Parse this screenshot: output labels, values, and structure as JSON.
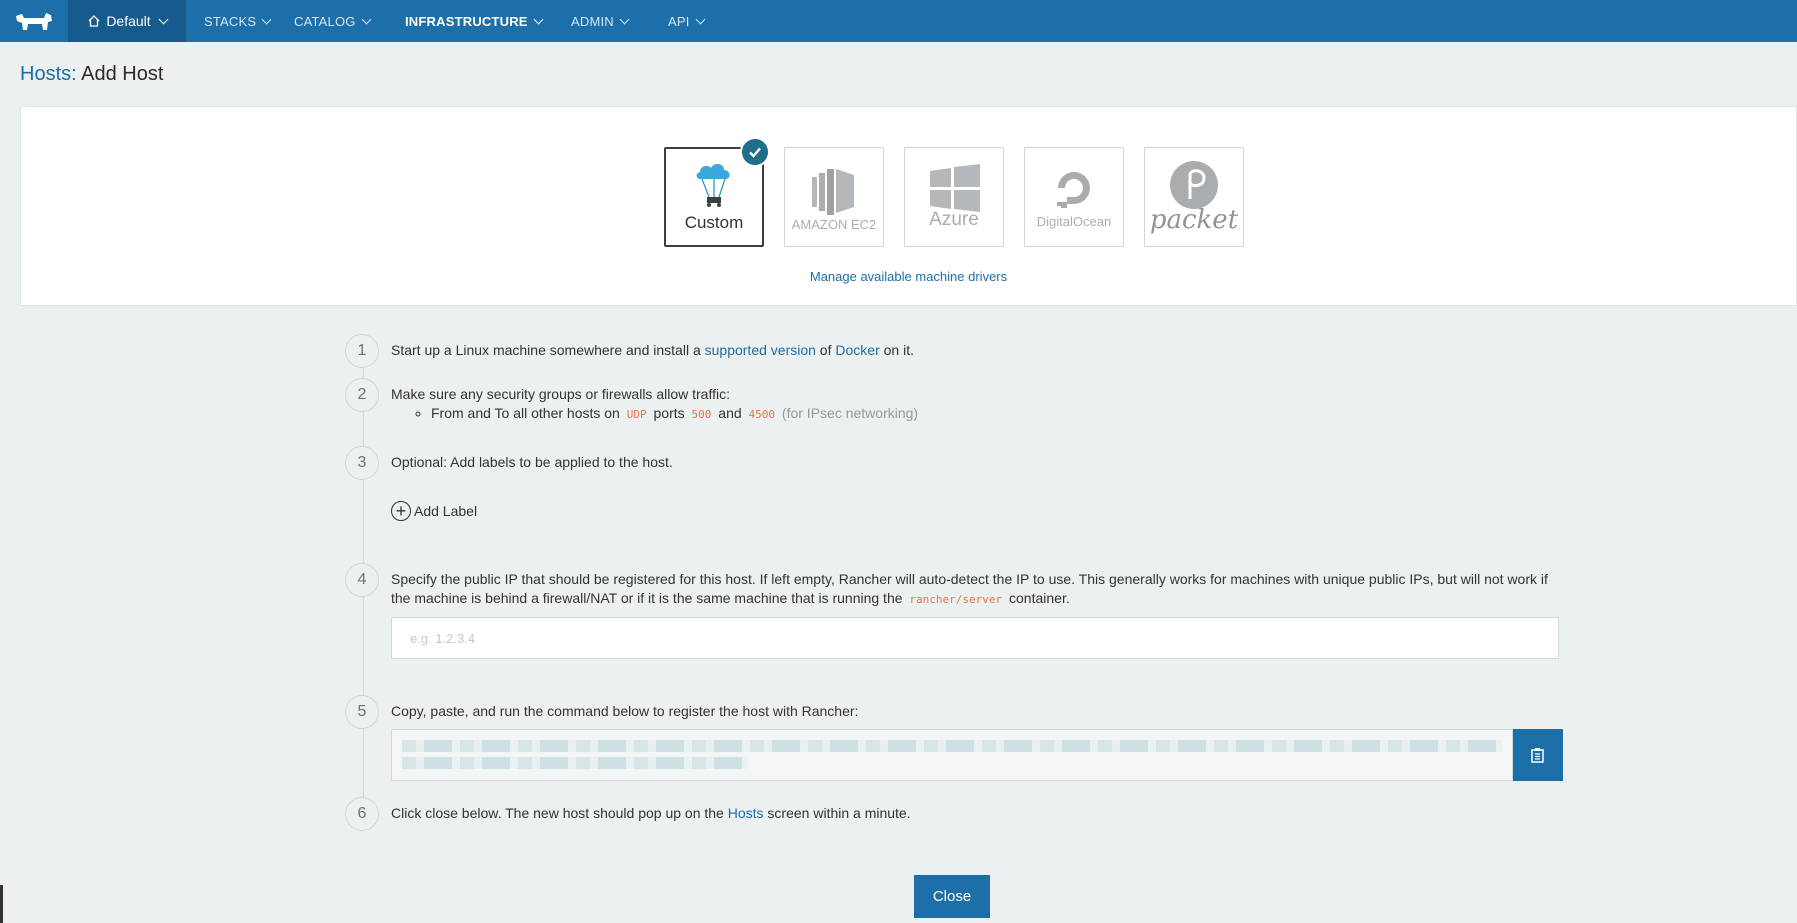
{
  "nav": {
    "environment": "Default",
    "items": [
      {
        "label": "STACKS"
      },
      {
        "label": "CATALOG"
      },
      {
        "label": "INFRASTRUCTURE",
        "active": true
      },
      {
        "label": "ADMIN"
      },
      {
        "label": "API"
      }
    ]
  },
  "page": {
    "breadcrumb": "Hosts:",
    "title": "Add Host"
  },
  "drivers": {
    "items": [
      {
        "label": "Custom",
        "selected": true
      },
      {
        "label": "AMAZON EC2"
      },
      {
        "label": "Azure"
      },
      {
        "label": "DigitalOcean"
      },
      {
        "label": "packet"
      }
    ],
    "manage_link": "Manage available machine drivers"
  },
  "steps": {
    "s1": {
      "num": "1",
      "pre": "Start up a Linux machine somewhere and install a ",
      "link1": "supported version",
      "mid": " of ",
      "link2": "Docker",
      "post": " on it."
    },
    "s2": {
      "num": "2",
      "text": "Make sure any security groups or firewalls allow traffic:",
      "bullet_pre": "From and To all other hosts on ",
      "proto": "UDP",
      "ports_label": " ports ",
      "port1": "500",
      "and": " and ",
      "port2": "4500",
      "note": " (for IPsec networking)"
    },
    "s3": {
      "num": "3",
      "text": "Optional: Add labels to be applied to the host.",
      "add_label": "Add Label"
    },
    "s4": {
      "num": "4",
      "text_pre": "Specify the public IP that should be registered for this host. If left empty, Rancher will auto-detect the IP to use. This generally works for machines with unique public IPs, but will not work if the machine is behind a firewall/NAT or if it is the same machine that is running the ",
      "code": "rancher/server",
      "text_post": " container.",
      "placeholder": "e.g. 1.2.3.4"
    },
    "s5": {
      "num": "5",
      "text": "Copy, paste, and run the command below to register the host with Rancher:"
    },
    "s6": {
      "num": "6",
      "pre": "Click close below. The new host should pop up on the ",
      "link": "Hosts",
      "post": " screen within a minute."
    }
  },
  "close_label": "Close",
  "colors": {
    "primary": "#1c6fa9",
    "nav_dark": "#155b8e",
    "background": "#ecf0f1",
    "code": "#e2764c",
    "check": "#1f6e8c"
  }
}
